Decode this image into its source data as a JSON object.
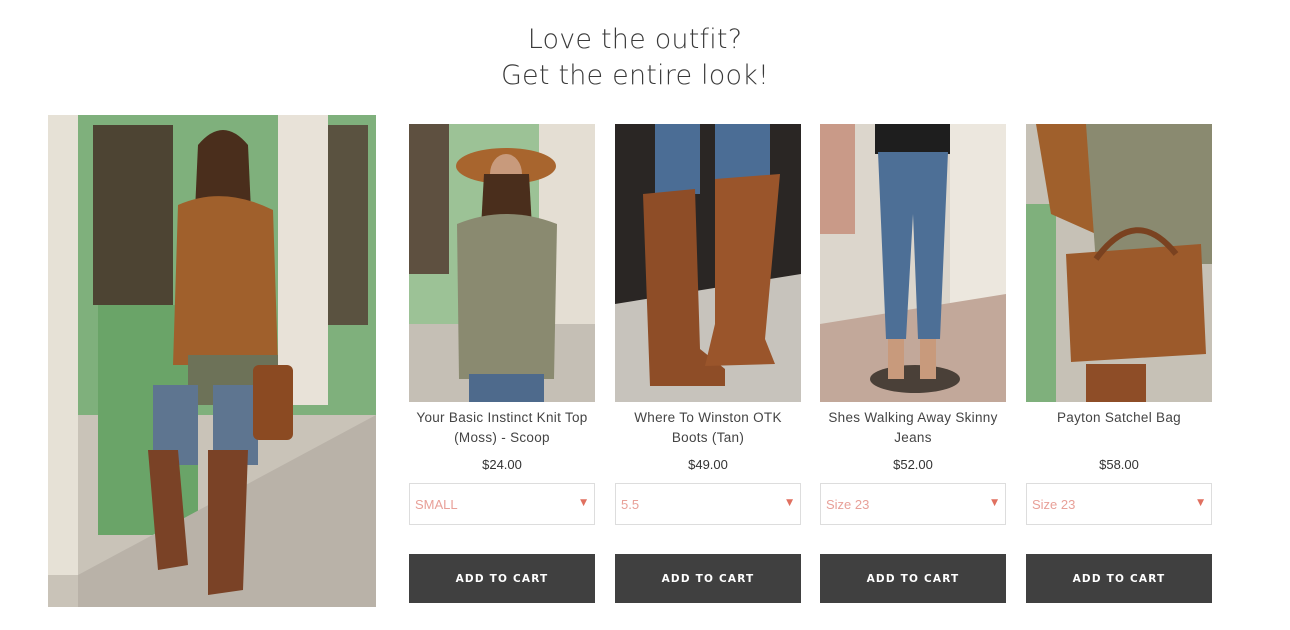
{
  "heading": {
    "line1": "Love the outfit?",
    "line2": "Get the entire look!"
  },
  "hero": {
    "icon": "outfit-photo"
  },
  "products": [
    {
      "name": "Your Basic Instinct Knit Top (Moss) - Scoop",
      "price": "$24.00",
      "size": "SMALL",
      "button": "ADD TO CART",
      "icon": "knit-top-photo"
    },
    {
      "name": "Where To Winston OTK Boots (Tan)",
      "price": "$49.00",
      "size": "5.5",
      "button": "ADD TO CART",
      "icon": "boots-photo"
    },
    {
      "name": "Shes Walking Away Skinny Jeans",
      "price": "$52.00",
      "size": "Size 23",
      "button": "ADD TO CART",
      "icon": "jeans-photo"
    },
    {
      "name": "Payton Satchel Bag",
      "price": "$58.00",
      "size": "Size 23",
      "button": "ADD TO CART",
      "icon": "satchel-bag-photo"
    }
  ],
  "colors": {
    "button_bg": "#404040",
    "select_text": "#e8a098",
    "caret": "#e07060"
  }
}
